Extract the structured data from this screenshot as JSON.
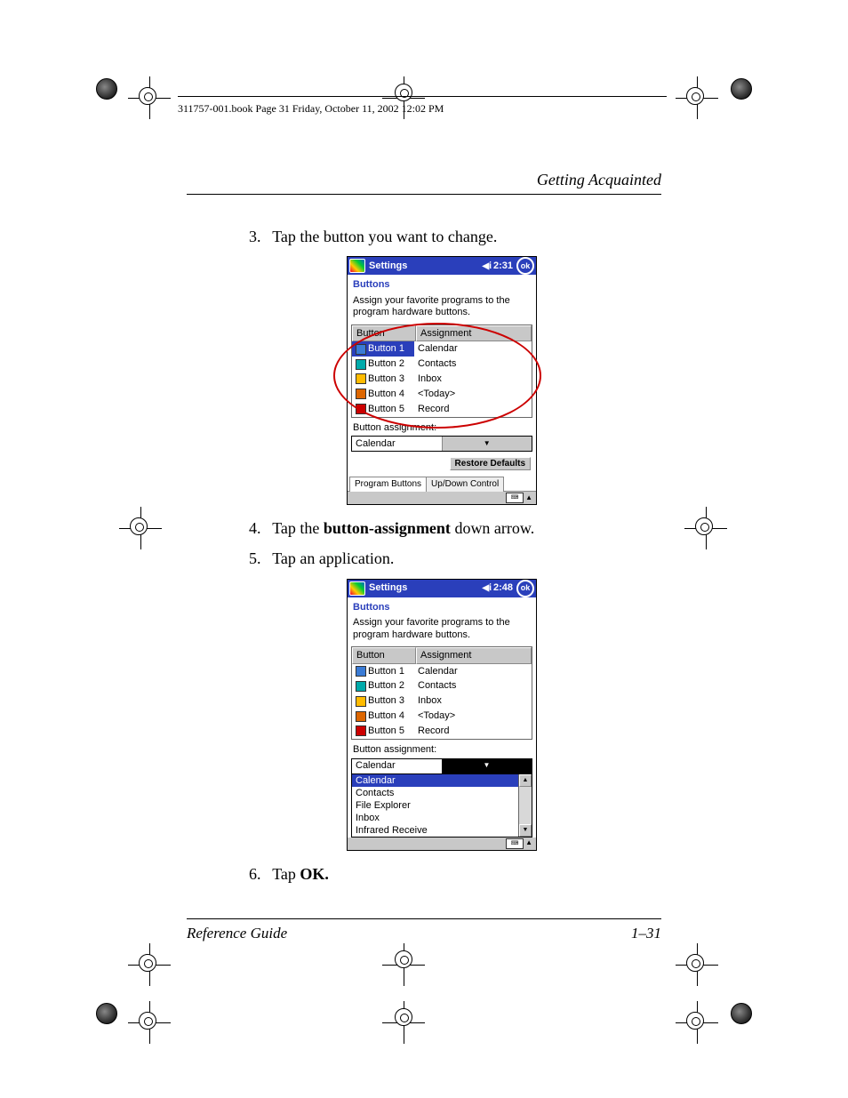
{
  "header_line": "311757-001.book  Page 31  Friday, October 11, 2002  12:02 PM",
  "section_title": "Getting Acquainted",
  "steps": {
    "s3": {
      "num": "3.",
      "text": "Tap the button you want to change."
    },
    "s4": {
      "num": "4.",
      "pre": "Tap the ",
      "bold": "button-assignment",
      "post": " down arrow."
    },
    "s5": {
      "num": "5.",
      "text": "Tap an application."
    },
    "s6": {
      "num": "6.",
      "pre": "Tap ",
      "bold": "OK."
    }
  },
  "device1": {
    "title": "Settings",
    "time": "2:31",
    "ok": "ok",
    "heading": "Buttons",
    "desc": "Assign your favorite programs to the program hardware buttons.",
    "col1": "Button",
    "col2": "Assignment",
    "rows": [
      {
        "name": "Button 1",
        "assign": "Calendar"
      },
      {
        "name": "Button 2",
        "assign": "Contacts"
      },
      {
        "name": "Button 3",
        "assign": "Inbox"
      },
      {
        "name": "Button 4",
        "assign": "<Today>"
      },
      {
        "name": "Button 5",
        "assign": "Record"
      }
    ],
    "sublabel": "Button assignment:",
    "dd_value": "Calendar",
    "restore": "Restore Defaults",
    "tab1": "Program Buttons",
    "tab2": "Up/Down Control"
  },
  "device2": {
    "title": "Settings",
    "time": "2:48",
    "ok": "ok",
    "heading": "Buttons",
    "desc": "Assign your favorite programs to the program hardware buttons.",
    "col1": "Button",
    "col2": "Assignment",
    "rows": [
      {
        "name": "Button 1",
        "assign": "Calendar"
      },
      {
        "name": "Button 2",
        "assign": "Contacts"
      },
      {
        "name": "Button 3",
        "assign": "Inbox"
      },
      {
        "name": "Button 4",
        "assign": "<Today>"
      },
      {
        "name": "Button 5",
        "assign": "Record"
      }
    ],
    "sublabel": "Button assignment:",
    "dd_value": "Calendar",
    "options": [
      "Calendar",
      "Contacts",
      "File Explorer",
      "Inbox",
      "Infrared Receive"
    ]
  },
  "footer_left": "Reference Guide",
  "footer_right": "1–31"
}
